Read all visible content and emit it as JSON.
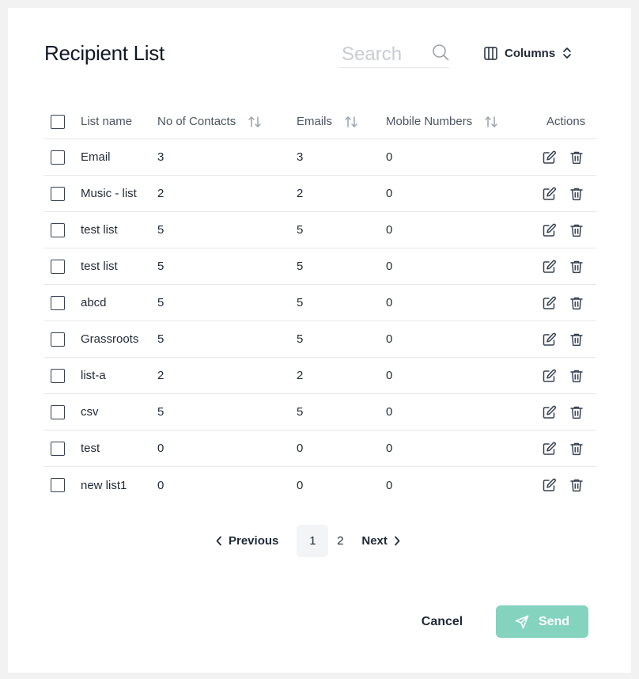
{
  "modal": {
    "title": "Recipient List",
    "search": {
      "placeholder": "Search",
      "value": ""
    },
    "columns_label": "Columns"
  },
  "table": {
    "headers": {
      "name": "List name",
      "contacts": "No of Contacts",
      "emails": "Emails",
      "mobile": "Mobile Numbers",
      "actions": "Actions"
    },
    "rows": [
      {
        "name": "Email",
        "contacts": "3",
        "emails": "3",
        "mobile": "0"
      },
      {
        "name": "Music - list",
        "contacts": "2",
        "emails": "2",
        "mobile": "0"
      },
      {
        "name": "test list",
        "contacts": "5",
        "emails": "5",
        "mobile": "0"
      },
      {
        "name": "test list",
        "contacts": "5",
        "emails": "5",
        "mobile": "0"
      },
      {
        "name": "abcd",
        "contacts": "5",
        "emails": "5",
        "mobile": "0"
      },
      {
        "name": "Grassroots",
        "contacts": "5",
        "emails": "5",
        "mobile": "0"
      },
      {
        "name": "list-a",
        "contacts": "2",
        "emails": "2",
        "mobile": "0"
      },
      {
        "name": "csv",
        "contacts": "5",
        "emails": "5",
        "mobile": "0"
      },
      {
        "name": "test",
        "contacts": "0",
        "emails": "0",
        "mobile": "0"
      },
      {
        "name": "new list1",
        "contacts": "0",
        "emails": "0",
        "mobile": "0"
      }
    ]
  },
  "pagination": {
    "previous_label": "Previous",
    "pages": [
      "1",
      "2"
    ],
    "current_page": "1",
    "next_label": "Next"
  },
  "footer": {
    "cancel_label": "Cancel",
    "send_label": "Send"
  },
  "colors": {
    "send_button": "#84d3be",
    "active_page_bg": "#f3f4f6",
    "divider": "#e5e7eb"
  },
  "icons": {
    "search": "search-icon",
    "columns": "columns-icon",
    "selector": "chevron-up-down-icon",
    "sort": "sort-arrows-icon",
    "edit": "edit-icon",
    "delete": "trash-icon",
    "prev": "chevron-left-icon",
    "next": "chevron-right-icon",
    "send": "paper-plane-icon"
  }
}
